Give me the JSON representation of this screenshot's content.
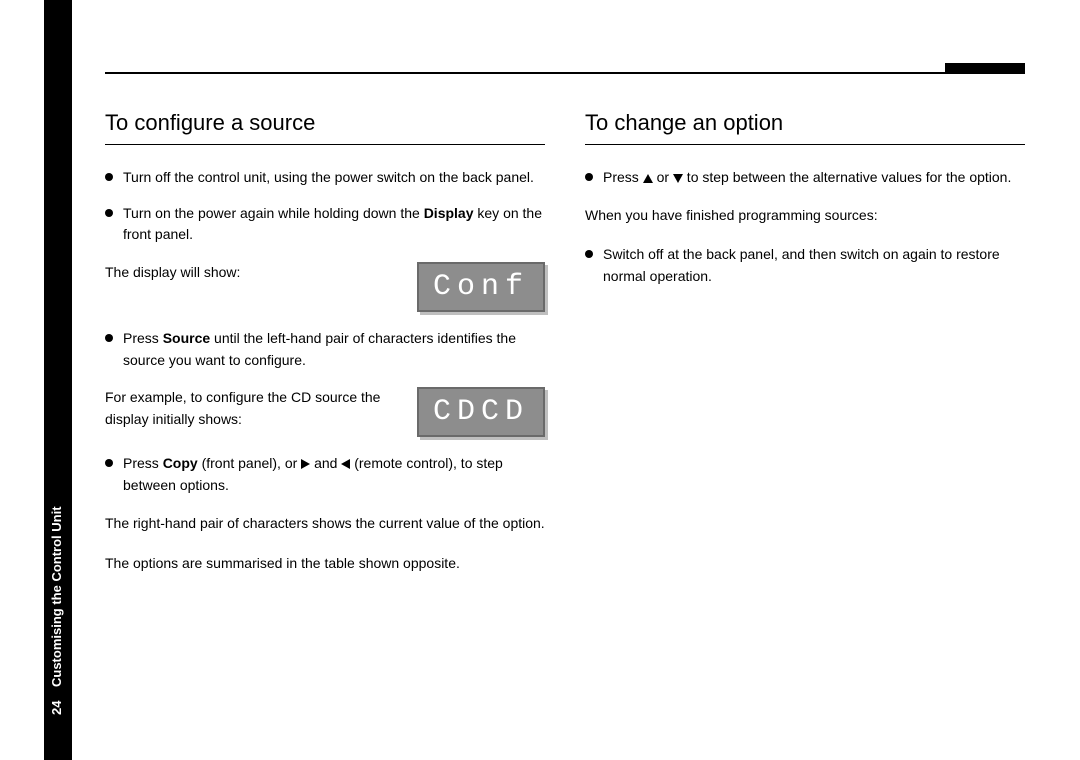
{
  "page_number": "24",
  "chapter": "Customising the Control Unit",
  "left": {
    "heading": "To configure a source",
    "b1a": "Turn off the control unit, using the power switch on the back panel.",
    "b1b_pre": "Turn on the power again while holding down the ",
    "b1b_key": "Display",
    "b1b_post": " key on the front panel.",
    "p1": "The display will show:",
    "lcd1": "Conf",
    "b2_pre": "Press ",
    "b2_key": "Source",
    "b2_post": " until the left-hand pair of characters identifies the source you want to configure.",
    "p2": "For example, to configure the CD source the display initially shows:",
    "lcd2": "CDCD",
    "b3_pre": "Press ",
    "b3_key": "Copy",
    "b3_mid1": " (front panel), or ",
    "b3_mid2": " and ",
    "b3_post": " (remote control), to step between options.",
    "p3": "The right-hand pair of characters shows the current value of the option.",
    "p4": "The options are summarised in the table shown opposite."
  },
  "right": {
    "heading": "To change an option",
    "b1_pre": "Press ",
    "b1_mid": " or ",
    "b1_post": " to step between the alternative values for the option.",
    "p1": "When you have finished programming sources:",
    "b2": "Switch off at the back panel, and then switch on again to restore normal operation."
  }
}
